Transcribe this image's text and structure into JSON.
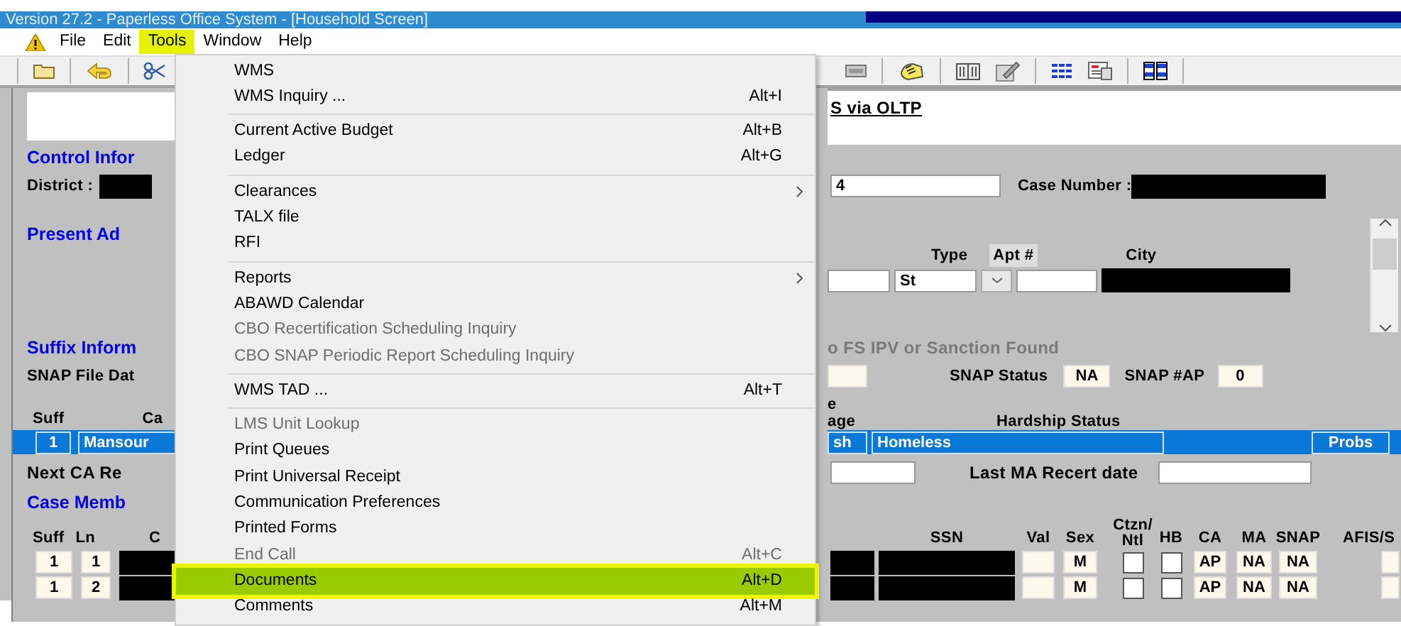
{
  "title_bar": {
    "title": "Version 27.2 - Paperless Office System - [Household Screen]"
  },
  "menu_bar": [
    {
      "label": "File",
      "open": false
    },
    {
      "label": "Edit",
      "open": false
    },
    {
      "label": "Tools",
      "open": true
    },
    {
      "label": "Window",
      "open": false
    },
    {
      "label": "Help",
      "open": false
    }
  ],
  "header_panel": {
    "link": "S via OLTP"
  },
  "control_information": {
    "heading": "Control Infor",
    "district_label": "District :",
    "field_value": "4",
    "case_number_label": "Case Number :"
  },
  "present_address": {
    "heading": "Present Ad",
    "type_label": "Type",
    "type_value": "St",
    "apt_label": "Apt #",
    "city_label": "City"
  },
  "suffix_information": {
    "heading": "Suffix Inform",
    "notice": "o FS IPV or Sanction Found",
    "snap_file_label": "SNAP File Dat",
    "snap_status_label": "SNAP Status",
    "snap_status": "NA",
    "snap_ap_label": "SNAP #AP",
    "snap_ap": "0",
    "columns": {
      "suff": "Suff",
      "column_2": "Ca",
      "column_3": [
        "e",
        "age"
      ],
      "hardship": "Hardship Status"
    },
    "rows": [
      {
        "suff": "1",
        "column_2": "Mansour",
        "column_3": "sh",
        "column_4": "Homeless",
        "button": "Probs",
        "selected": true
      }
    ],
    "next_ca_label": "Next CA Re",
    "last_ma_label": "Last MA Recert date"
  },
  "case_members": {
    "heading": "Case Memb",
    "columns": {
      "suff": "Suff",
      "ln": "Ln",
      "column_3": "C",
      "ssn": "SSN",
      "val": "Val",
      "sex": "Sex",
      "ctzn": [
        "Ctzn/",
        "Ntl"
      ],
      "hb": "HB",
      "ca": "CA",
      "ma": "MA",
      "snap": "SNAP",
      "afis": "AFIS/S"
    },
    "rows": [
      {
        "suff": "1",
        "ln": "1",
        "sex": "M",
        "ctzn_checked": false,
        "hb_checked": false,
        "ca": "AP",
        "ma": "NA",
        "snap": "NA"
      },
      {
        "suff": "1",
        "ln": "2",
        "sex": "M",
        "ctzn_checked": false,
        "hb_checked": false,
        "ca": "AP",
        "ma": "NA",
        "snap": "NA"
      }
    ]
  },
  "tools_menu": [
    {
      "kind": "item",
      "label": "WMS",
      "disabled": false,
      "highlighted": false
    },
    {
      "kind": "item",
      "label": "WMS Inquiry ...",
      "shortcut": "Alt+I",
      "disabled": false,
      "highlighted": false
    },
    {
      "kind": "separator"
    },
    {
      "kind": "item",
      "label": "Current Active Budget",
      "shortcut": "Alt+B",
      "disabled": false,
      "highlighted": false
    },
    {
      "kind": "item",
      "label": "Ledger",
      "shortcut": "Alt+G",
      "disabled": false,
      "highlighted": false
    },
    {
      "kind": "separator"
    },
    {
      "kind": "item",
      "label": "Clearances",
      "submenu": true,
      "disabled": false,
      "highlighted": false
    },
    {
      "kind": "item",
      "label": "TALX file",
      "disabled": false,
      "highlighted": false
    },
    {
      "kind": "item",
      "label": "RFI",
      "disabled": false,
      "highlighted": false
    },
    {
      "kind": "separator"
    },
    {
      "kind": "item",
      "label": "Reports",
      "submenu": true,
      "disabled": false,
      "highlighted": false
    },
    {
      "kind": "item",
      "label": "ABAWD Calendar",
      "disabled": false,
      "highlighted": false
    },
    {
      "kind": "item",
      "label": "CBO Recertification Scheduling Inquiry",
      "disabled": true,
      "highlighted": false
    },
    {
      "kind": "item",
      "label": "CBO SNAP Periodic Report Scheduling Inquiry",
      "disabled": true,
      "highlighted": false
    },
    {
      "kind": "separator"
    },
    {
      "kind": "item",
      "label": "WMS TAD ...",
      "shortcut": "Alt+T",
      "disabled": false,
      "highlighted": false
    },
    {
      "kind": "separator"
    },
    {
      "kind": "item",
      "label": "LMS Unit Lookup",
      "disabled": true,
      "highlighted": false
    },
    {
      "kind": "item",
      "label": "Print Queues",
      "disabled": false,
      "highlighted": false
    },
    {
      "kind": "item",
      "label": "Print Universal Receipt",
      "disabled": false,
      "highlighted": false
    },
    {
      "kind": "item",
      "label": "Communication Preferences",
      "disabled": false,
      "highlighted": false
    },
    {
      "kind": "item",
      "label": "Printed Forms",
      "disabled": false,
      "highlighted": false
    },
    {
      "kind": "item",
      "label": "End Call",
      "shortcut": "Alt+C",
      "disabled": true,
      "highlighted": false
    },
    {
      "kind": "item",
      "label": "Documents",
      "shortcut": "Alt+D",
      "disabled": false,
      "highlighted": true
    },
    {
      "kind": "item",
      "label": "Comments",
      "shortcut": "Alt+M",
      "disabled": false,
      "highlighted": false
    }
  ]
}
